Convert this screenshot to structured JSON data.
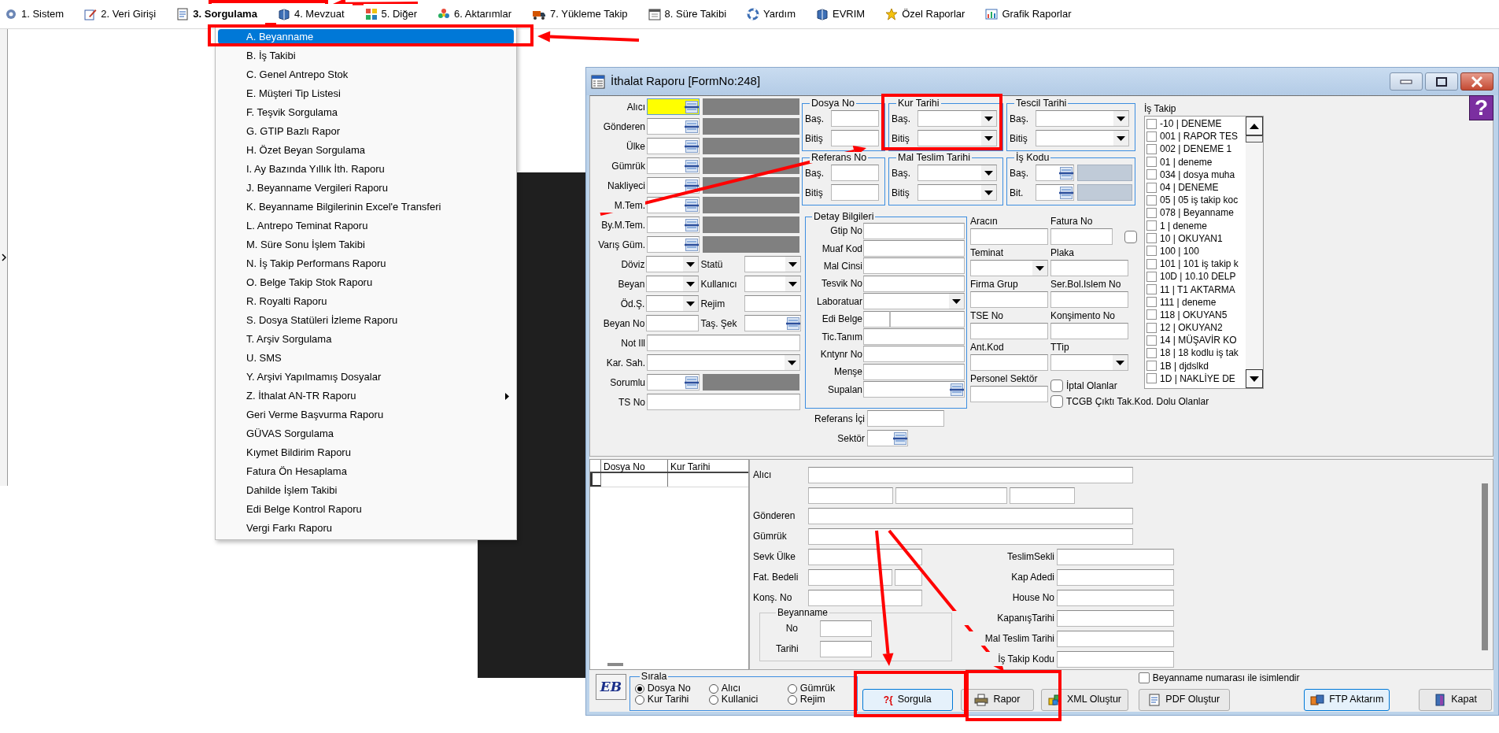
{
  "menu_bar": [
    {
      "label": "1. Sistem",
      "kind": "gear",
      "selected": false
    },
    {
      "label": "2. Veri Girişi",
      "kind": "pencil",
      "selected": false
    },
    {
      "label": "3. Sorgulama",
      "kind": "document",
      "selected": true
    },
    {
      "label": "4. Mevzuat",
      "kind": "book",
      "selected": false
    },
    {
      "label": "5. Diğer",
      "kind": "squares",
      "selected": false
    },
    {
      "label": "6. Aktarımlar",
      "kind": "flower",
      "selected": false
    },
    {
      "label": "7. Yükleme Takip",
      "kind": "truck",
      "selected": false
    },
    {
      "label": "8. Süre Takibi",
      "kind": "calendar",
      "selected": false
    },
    {
      "label": "Yardım",
      "kind": "lifebuoy",
      "selected": false
    },
    {
      "label": "EVRIM",
      "kind": "book",
      "selected": false
    },
    {
      "label": "Özel Raporlar",
      "kind": "star",
      "selected": false
    },
    {
      "label": "Grafik Raporlar",
      "kind": "chart",
      "selected": false
    }
  ],
  "dropdown_menu": {
    "items": [
      {
        "label": "A. Beyanname",
        "selected": true,
        "submenu": false
      },
      {
        "label": "B. İş Takibi",
        "selected": false,
        "submenu": false
      },
      {
        "label": "C. Genel Antrepo Stok",
        "selected": false,
        "submenu": false
      },
      {
        "label": "E. Müşteri Tip Listesi",
        "selected": false,
        "submenu": false
      },
      {
        "label": "F. Teşvik Sorgulama",
        "selected": false,
        "submenu": false
      },
      {
        "label": "G. GTIP Bazlı Rapor",
        "selected": false,
        "submenu": false
      },
      {
        "label": "H. Özet Beyan Sorgulama",
        "selected": false,
        "submenu": false
      },
      {
        "label": "I. Ay Bazında Yıllık İth. Raporu",
        "selected": false,
        "submenu": false
      },
      {
        "label": "J. Beyanname Vergileri Raporu",
        "selected": false,
        "submenu": false
      },
      {
        "label": "K. Beyanname Bilgilerinin Excel'e Transferi",
        "selected": false,
        "submenu": false
      },
      {
        "label": "L. Antrepo Teminat Raporu",
        "selected": false,
        "submenu": false
      },
      {
        "label": "M. Süre Sonu İşlem Takibi",
        "selected": false,
        "submenu": false
      },
      {
        "label": "N. İş Takip Performans Raporu",
        "selected": false,
        "submenu": false
      },
      {
        "label": "O. Belge Takip Stok Raporu",
        "selected": false,
        "submenu": false
      },
      {
        "label": "R. Royalti Raporu",
        "selected": false,
        "submenu": false
      },
      {
        "label": "S. Dosya Statüleri İzleme Raporu",
        "selected": false,
        "submenu": false
      },
      {
        "label": "T. Arşiv Sorgulama",
        "selected": false,
        "submenu": false
      },
      {
        "label": "U. SMS",
        "selected": false,
        "submenu": false
      },
      {
        "label": "Y. Arşivi Yapılmamış Dosyalar",
        "selected": false,
        "submenu": false
      },
      {
        "label": "Z. İthalat AN-TR Raporu",
        "selected": false,
        "submenu": true
      },
      {
        "label": "Geri Verme Başvurma Raporu",
        "selected": false,
        "submenu": false
      },
      {
        "label": "GÜVAS Sorgulama",
        "selected": false,
        "submenu": false
      },
      {
        "label": "Kıymet Bildirim Raporu",
        "selected": false,
        "submenu": false
      },
      {
        "label": "Fatura Ön Hesaplama",
        "selected": false,
        "submenu": false
      },
      {
        "label": "Dahilde İşlem Takibi",
        "selected": false,
        "submenu": false
      },
      {
        "label": "Edi Belge Kontrol Raporu",
        "selected": false,
        "submenu": false
      },
      {
        "label": "Vergi Farkı Raporu",
        "selected": false,
        "submenu": false
      }
    ]
  },
  "window": {
    "title": "İthalat Raporu [FormNo:248]",
    "help_button": "?"
  },
  "general_fields": [
    {
      "kind": "lookup",
      "label": "Alıcı",
      "focused": true
    },
    {
      "kind": "lookup",
      "label": "Gönderen",
      "focused": false
    },
    {
      "kind": "lookup",
      "label": "Ülke",
      "focused": false
    },
    {
      "kind": "lookup",
      "label": "Gümrük",
      "focused": false
    },
    {
      "kind": "lookup",
      "label": "Nakliyeci",
      "focused": false
    },
    {
      "kind": "lookup",
      "label": "M.Tem.",
      "focused": false
    },
    {
      "kind": "lookup",
      "label": "By.M.Tem.",
      "focused": false
    },
    {
      "kind": "lookup",
      "label": "Varış Güm.",
      "focused": false
    },
    {
      "kind": "pair",
      "items": [
        {
          "label": "Döviz",
          "kind": "combo"
        },
        {
          "label": "Statü",
          "kind": "combo"
        }
      ]
    },
    {
      "kind": "pair",
      "items": [
        {
          "label": "Beyan",
          "kind": "combo"
        },
        {
          "label": "Kullanıcı",
          "kind": "combo"
        }
      ]
    },
    {
      "kind": "pair",
      "items": [
        {
          "label": "Öd.Ş.",
          "kind": "combo"
        },
        {
          "label": "Rejim",
          "kind": "text"
        }
      ]
    },
    {
      "kind": "pair",
      "items": [
        {
          "label": "Beyan No",
          "kind": "text"
        },
        {
          "label": "Taş. Şek",
          "kind": "lookup"
        }
      ]
    },
    {
      "kind": "text_wide",
      "label": "Not Ill"
    },
    {
      "kind": "combo_wide",
      "label": "Kar. Sah."
    },
    {
      "kind": "lookup",
      "label": "Sorumlu",
      "focused": false
    },
    {
      "kind": "text_wide",
      "label": "TS No"
    }
  ],
  "range_groups": [
    {
      "title": "Dosya No",
      "kind": "text",
      "rows": [
        "Baş.",
        "Bitiş"
      ]
    },
    {
      "title": "Kur Tarihi",
      "kind": "combo",
      "rows": [
        "Baş.",
        "Bitiş"
      ]
    },
    {
      "title": "Tescil Tarihi",
      "kind": "combo",
      "rows": [
        "Baş.",
        "Bitiş"
      ]
    },
    {
      "title": "Referans No",
      "kind": "text",
      "rows": [
        "Baş.",
        "Bitiş"
      ]
    },
    {
      "title": "Mal Teslim Tarihi",
      "kind": "combo",
      "rows": [
        "Baş.",
        "Bitiş"
      ]
    },
    {
      "title": "İş Kodu",
      "kind": "lookup",
      "rows": [
        "Baş.",
        "Bit."
      ]
    }
  ],
  "detail_group": {
    "title": "Detay Bilgileri",
    "fields": [
      {
        "label": "Gtip No",
        "kind": "text"
      },
      {
        "label": "Muaf Kod",
        "kind": "text"
      },
      {
        "label": "Mal Cinsi",
        "kind": "text"
      },
      {
        "label": "Tesvik No",
        "kind": "text"
      },
      {
        "label": "Laboratuar",
        "kind": "combo"
      },
      {
        "label": "Edi Belge",
        "kind": "split"
      },
      {
        "label": "Tic.Tanım",
        "kind": "text"
      },
      {
        "label": "Kntynr No",
        "kind": "text"
      },
      {
        "label": "Menşe",
        "kind": "text"
      },
      {
        "label": "Supalan",
        "kind": "lookup"
      }
    ]
  },
  "extra_fields": [
    {
      "label": "Referans İçi",
      "kind": "text"
    },
    {
      "label": "Sektör",
      "kind": "lookup"
    }
  ],
  "side_fields": [
    {
      "label": "Aracın",
      "kind": "text"
    },
    {
      "label": "Fatura No",
      "kind": "text",
      "checked": false
    },
    {
      "label": "Teminat",
      "kind": "combo"
    },
    {
      "label": "Plaka",
      "kind": "text"
    },
    {
      "label": "Firma Grup",
      "kind": "text"
    },
    {
      "label": "Ser.Bol.Islem No",
      "kind": "text"
    },
    {
      "label": "TSE No",
      "kind": "text"
    },
    {
      "label": "Konşimento No",
      "kind": "text"
    },
    {
      "label": "Ant.Kod",
      "kind": "text"
    },
    {
      "label": "TTip",
      "kind": "combo"
    },
    {
      "label": "Personel Sektör",
      "kind": "text"
    }
  ],
  "filters": [
    {
      "label": "İptal Olanlar",
      "checked": false
    },
    {
      "label": "TCGB Çıktı Tak.Kod. Dolu Olanlar",
      "checked": false
    }
  ],
  "job_tracking": {
    "title": "İş Takip",
    "items": [
      {
        "label": "-10 | DENEME",
        "checked": false
      },
      {
        "label": "001 | RAPOR TES",
        "checked": false
      },
      {
        "label": "002 | DENEME 1",
        "checked": false
      },
      {
        "label": "01 | deneme",
        "checked": false
      },
      {
        "label": "034 | dosya muha",
        "checked": false
      },
      {
        "label": "04 | DENEME",
        "checked": false
      },
      {
        "label": "05 | 05 iş takip koc",
        "checked": false
      },
      {
        "label": "078 | Beyanname",
        "checked": false
      },
      {
        "label": "1 | deneme",
        "checked": false
      },
      {
        "label": "10 | OKUYAN1",
        "checked": false
      },
      {
        "label": "100 | 100",
        "checked": false
      },
      {
        "label": "101 | 101 iş takip k",
        "checked": false
      },
      {
        "label": "10D | 10.10 DELP",
        "checked": false
      },
      {
        "label": "11 | T1 AKTARMA",
        "checked": false
      },
      {
        "label": "111 | deneme",
        "checked": false
      },
      {
        "label": "118 | OKUYAN5",
        "checked": false
      },
      {
        "label": "12 | OKUYAN2",
        "checked": false
      },
      {
        "label": "14 | MÜŞAVİR KO",
        "checked": false
      },
      {
        "label": "18 | 18 kodlu iş tak",
        "checked": false
      },
      {
        "label": "1B | djdslkd",
        "checked": false
      },
      {
        "label": "1D | NAKLİYE DE",
        "checked": false
      }
    ]
  },
  "results_table": {
    "columns": [
      "Dosya No",
      "Kur Tarihi"
    ]
  },
  "detail_panel": {
    "top_fields": [
      {
        "label": "Alıcı"
      },
      {
        "label": "Gönderen"
      },
      {
        "label": "Gümrük"
      }
    ],
    "left_fields": [
      {
        "label": "Sevk Ülke",
        "kind": "text"
      },
      {
        "label": "Fat. Bedeli",
        "kind": "amount"
      },
      {
        "label": "Konş. No",
        "kind": "text"
      }
    ],
    "declaration_group": {
      "title": "Beyanname",
      "fields": [
        "No",
        "Tarihi"
      ]
    },
    "right_fields": [
      "TeslimSekli",
      "Kap Adedi",
      "House No",
      "KapanışTarihi",
      "Mal Teslim Tarihi",
      "İş Takip Kodu"
    ]
  },
  "logo": "EB",
  "sort_group": {
    "title": "Sırala",
    "options": [
      {
        "label": "Dosya No",
        "selected": true
      },
      {
        "label": "Kur Tarihi",
        "selected": false
      },
      {
        "label": "Alıcı",
        "selected": false
      },
      {
        "label": "Kullanici",
        "selected": false
      },
      {
        "label": "Gümrük",
        "selected": false
      },
      {
        "label": "Rejim",
        "selected": false
      }
    ]
  },
  "name_option": {
    "label": "Beyanname numarası ile isimlendir",
    "checked": false
  },
  "buttons": [
    {
      "label": "Sorgula",
      "kind": "glyph",
      "glyph": "?{",
      "focused": true
    },
    {
      "label": "Rapor",
      "kind": "printer",
      "focused": false
    },
    {
      "label": "XML Oluştur",
      "kind": "cubes",
      "focused": false
    },
    {
      "label": "PDF Oluştur",
      "kind": "document",
      "focused": false
    },
    {
      "label": "FTP Aktarım",
      "kind": "transfer",
      "focused": true
    },
    {
      "label": "Kapat",
      "kind": "door",
      "focused": false
    }
  ]
}
